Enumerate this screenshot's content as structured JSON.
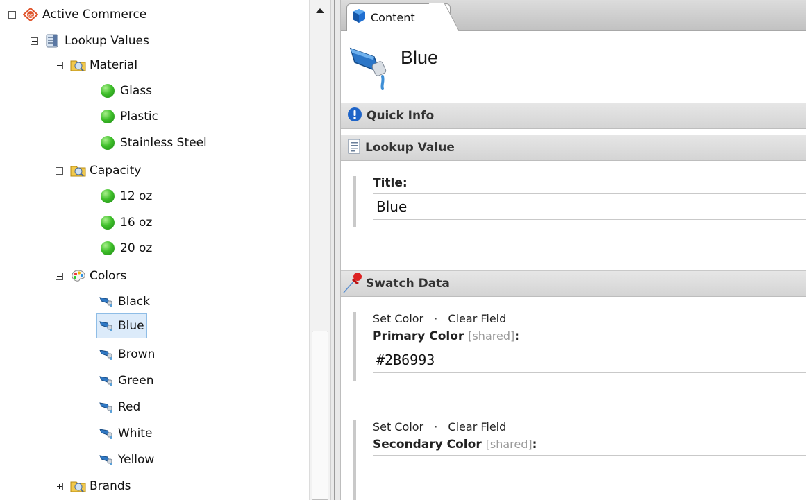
{
  "tree": {
    "root": {
      "label": "Active Commerce",
      "icon": "active-commerce-logo-icon"
    },
    "lookup": {
      "label": "Lookup Values",
      "icon": "database-icon"
    },
    "material": {
      "label": "Material",
      "icon": "folder-icon",
      "items": [
        "Glass",
        "Plastic",
        "Stainless Steel"
      ]
    },
    "capacity": {
      "label": "Capacity",
      "icon": "folder-icon",
      "items": [
        "12 oz",
        "16 oz",
        "20 oz"
      ]
    },
    "colors": {
      "label": "Colors",
      "icon": "palette-icon",
      "items": [
        "Black",
        "Blue",
        "Brown",
        "Green",
        "Red",
        "White",
        "Yellow"
      ],
      "selected": "Blue"
    },
    "brands": {
      "label": "Brands",
      "icon": "folder-icon"
    }
  },
  "content": {
    "tab_label": "Content",
    "title": "Blue",
    "sections": {
      "quick_info": "Quick Info",
      "lookup_value": "Lookup Value",
      "swatch_data": "Swatch Data"
    },
    "title_field": {
      "label": "Title:",
      "value": "Blue"
    },
    "primary": {
      "set_color": "Set Color",
      "clear_field": "Clear Field",
      "separator": "·",
      "label": "Primary Color",
      "shared": "[shared]",
      "colon": ":",
      "value": "#2B6993"
    },
    "secondary": {
      "set_color": "Set Color",
      "clear_field": "Clear Field",
      "separator": "·",
      "label": "Secondary Color",
      "shared": "[shared]",
      "colon": ":",
      "value": ""
    }
  },
  "colors": {
    "selection_bg": "#dcebfa",
    "selection_border": "#8fbde6",
    "swatch_blue": "#2B6993"
  }
}
